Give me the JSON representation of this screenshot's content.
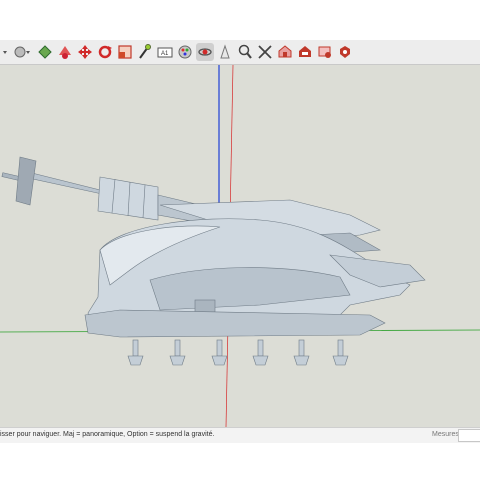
{
  "toolbar": {
    "tools": [
      {
        "name": "select-dropdown-icon",
        "color": "#555555"
      },
      {
        "name": "shapes-dropdown-icon",
        "color": "#888888"
      },
      {
        "name": "push-pull-icon",
        "color": "#2e8b57"
      },
      {
        "name": "paint-bucket-icon",
        "color": "#cc2233"
      },
      {
        "name": "move-icon",
        "color": "#d12a2a"
      },
      {
        "name": "rotate-icon",
        "color": "#d12a2a"
      },
      {
        "name": "scale-icon",
        "color": "#d04a2a"
      },
      {
        "name": "tape-measure-icon",
        "color": "#556b2f"
      },
      {
        "name": "text-icon",
        "color": "#444444"
      },
      {
        "name": "paint-icon",
        "color": "#777777"
      },
      {
        "name": "orbit-icon",
        "color": "#7a7a7a"
      },
      {
        "name": "walk-icon",
        "color": "#777777"
      },
      {
        "name": "zoom-icon",
        "color": "#555555"
      },
      {
        "name": "zoom-extents-icon",
        "color": "#444444"
      },
      {
        "name": "warehouse-icon",
        "color": "#c0392b"
      },
      {
        "name": "extension-warehouse-icon",
        "color": "#c0392b"
      },
      {
        "name": "send-to-layout-icon",
        "color": "#c0392b"
      },
      {
        "name": "extension-manager-icon",
        "color": "#c0392b"
      }
    ]
  },
  "status": {
    "hint": "isser pour naviguer. Maj = panoramique, Option = suspend la gravité.",
    "measure_label": "Mesures",
    "measure_value": ""
  },
  "axes": {
    "green": "#2ca02c",
    "red": "#d62728",
    "blue": "#1f3fd6"
  }
}
